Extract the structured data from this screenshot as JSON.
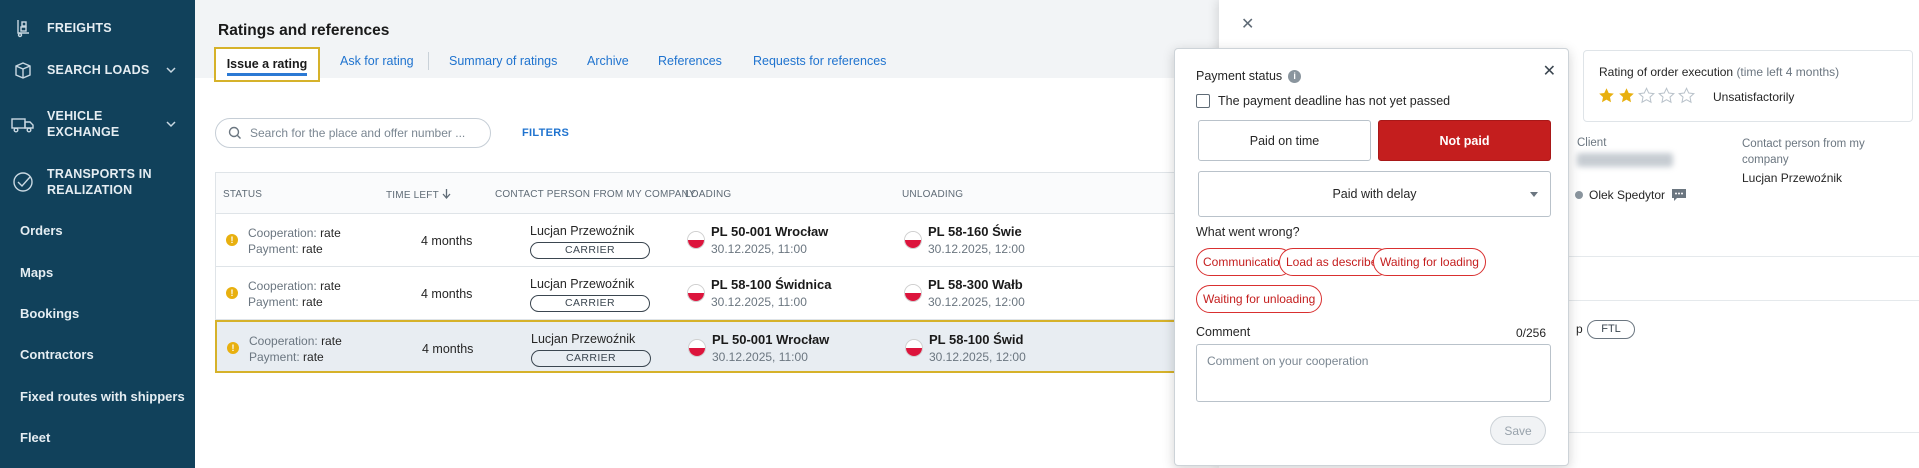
{
  "sidebar": {
    "main_items": [
      {
        "label": "FREIGHTS",
        "icon": "freight-icon"
      },
      {
        "label": "SEARCH LOADS",
        "icon": "box-icon"
      },
      {
        "label": "VEHICLE EXCHANGE",
        "icon": "truck-icon"
      },
      {
        "label": "TRANSPORTS IN REALIZATION",
        "icon": "check-circle-icon"
      }
    ],
    "sub_items": [
      "Orders",
      "Maps",
      "Bookings",
      "Contractors",
      "Fixed routes with shippers",
      "Fleet"
    ]
  },
  "page": {
    "title": "Ratings and references",
    "tabs": [
      "Issue a rating",
      "Ask for rating",
      "Summary of ratings",
      "Archive",
      "References",
      "Requests for references"
    ],
    "active_tab": "Issue a rating"
  },
  "search": {
    "placeholder": "Search for the place and offer number ...",
    "filters_label": "FILTERS"
  },
  "table": {
    "headers": [
      "STATUS",
      "TIME LEFT",
      "CONTACT PERSON FROM MY COMPANY",
      "LOADING",
      "UNLOADING"
    ],
    "status_labels": {
      "cooperation": "Cooperation:",
      "payment": "Payment:",
      "value": "rate"
    },
    "rows": [
      {
        "time_left": "4 months",
        "contact": "Lucjan Przewoźnik",
        "role": "CARRIER",
        "loading_place": "PL 50-001 Wrocław",
        "loading_date": "30.12.2025, 11:00",
        "unloading_place": "PL 58-160 Świe",
        "unloading_date": "30.12.2025, 12:00"
      },
      {
        "time_left": "4 months",
        "contact": "Lucjan Przewoźnik",
        "role": "CARRIER",
        "loading_place": "PL 58-100 Świdnica",
        "loading_date": "30.12.2025, 11:00",
        "unloading_place": "PL 58-300 Wałb",
        "unloading_date": "30.12.2025, 12:00"
      },
      {
        "time_left": "4 months",
        "contact": "Lucjan Przewoźnik",
        "role": "CARRIER",
        "loading_place": "PL 50-001 Wrocław",
        "loading_date": "30.12.2025, 11:00",
        "unloading_place": "PL 58-100 Świd",
        "unloading_date": "30.12.2025, 12:00"
      }
    ]
  },
  "panel": {
    "order_rating_title": "Rating of order execution",
    "order_rating_time": "(time left 4 months)",
    "order_rating_stars": 2,
    "order_rating_max": 5,
    "order_rating_word": "Unsatisfactorily",
    "client_label": "Client",
    "client_person": "Olek Spedytor",
    "contact_label": "Contact person from my company",
    "contact_value": "Lucjan Przewoźnik",
    "fragment": "p",
    "ftl": "FTL"
  },
  "popover": {
    "title": "Payment status",
    "deadline_label": "The payment deadline has not yet passed",
    "btn_on_time": "Paid on time",
    "btn_not_paid": "Not paid",
    "select_value": "Paid with delay",
    "what_wrong": "What went wrong?",
    "chips": [
      "Communication",
      "Load as described",
      "Waiting for loading",
      "Waiting for unloading"
    ],
    "comment_label": "Comment",
    "comment_count": "0/256",
    "comment_placeholder": "Comment on your cooperation",
    "save_label": "Save"
  },
  "colors": {
    "sidebar": "#11415b",
    "accent": "#1f73cf",
    "danger": "#c41e1e",
    "star": "#e8b00f",
    "highlight": "#d6b22a"
  }
}
